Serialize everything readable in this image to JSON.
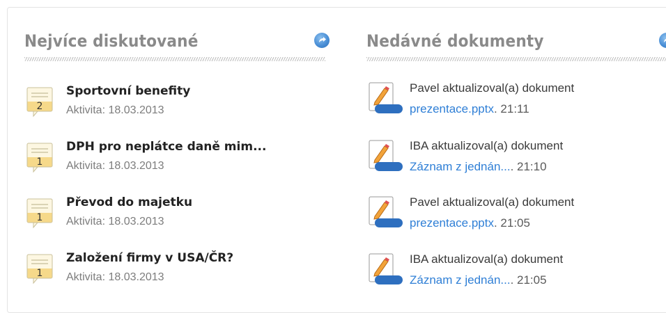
{
  "discussed": {
    "title": "Nejvíce diskutované",
    "more_icon": "arrow-circle-icon",
    "items": [
      {
        "title": "Sportovní benefity",
        "activity": "Aktivita: 18.03.2013",
        "count": "2"
      },
      {
        "title": "DPH pro neplátce daně mim...",
        "activity": "Aktivita: 18.03.2013",
        "count": "1"
      },
      {
        "title": "Převod do majetku",
        "activity": "Aktivita: 18.03.2013",
        "count": "1"
      },
      {
        "title": "Založení firmy v USA/ČR?",
        "activity": "Aktivita: 18.03.2013",
        "count": "1"
      }
    ]
  },
  "documents": {
    "title": "Nedávné dokumenty",
    "more_icon": "arrow-circle-icon",
    "items": [
      {
        "text": "Pavel aktualizoval(a) dokument",
        "link": "prezentace.pptx",
        "time": ". 21:11"
      },
      {
        "text": "IBA aktualizoval(a) dokument",
        "link": "Záznam z jednán...",
        "time": ". 21:10"
      },
      {
        "text": "Pavel aktualizoval(a) dokument",
        "link": "prezentace.pptx",
        "time": ". 21:05"
      },
      {
        "text": "IBA aktualizoval(a) dokument",
        "link": "Záznam z jednán...",
        "time": ". 21:05"
      }
    ]
  }
}
